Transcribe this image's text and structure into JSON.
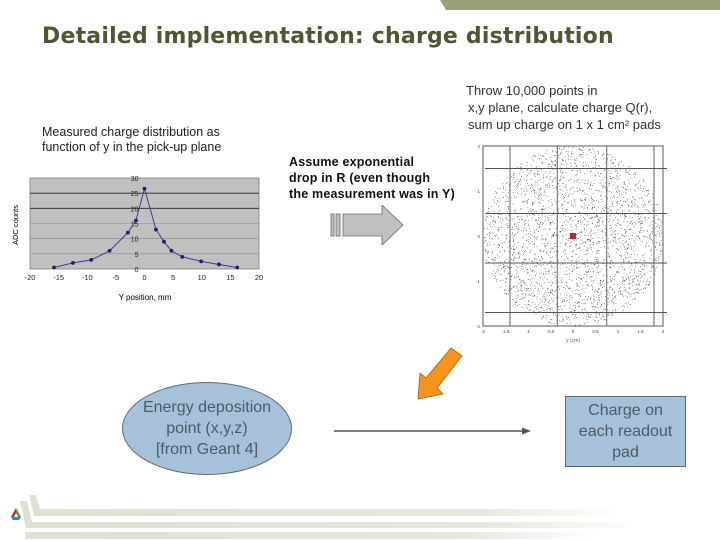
{
  "slide": {
    "title": "Detailed implementation: charge distribution",
    "measured_caption": [
      "Measured charge distribution as",
      "function of y in the pick-up plane"
    ],
    "throw_caption": [
      "Throw 10,000 points in",
      "x,y plane, calculate charge Q(r),",
      "sum up charge on 1 x 1 cm² pads"
    ],
    "assume_caption": [
      "Assume exponential",
      "drop in R (even though",
      "the measurement was in Y)"
    ],
    "ellipse_label": [
      "Energy deposition",
      "point (x,y,z)",
      "[from Geant 4]"
    ],
    "pad_label": [
      "Charge on",
      "each readout",
      "pad"
    ],
    "colors": {
      "title": "#4f5634",
      "top_band": "#9a9f78",
      "box_fill": "#a7c1db",
      "box_border": "#5b6b7c",
      "orange_arrow": "#f7941d",
      "grey_arrow": "#c0c0c0",
      "chart_bg": "#c0c0c0",
      "chart_line": "#2b2f8a",
      "footer_stripe": "#e3e4da"
    },
    "icons": {
      "logo": "argonne-triangle-logo",
      "grey_arrow": "right-arrow-icon",
      "orange_arrow": "down-left-arrow-icon",
      "flow_arrow": "right-line-arrow-icon"
    }
  },
  "chart_data": [
    {
      "type": "line",
      "title": "",
      "xlabel": "Y position, mm",
      "ylabel": "ADC counts",
      "xlim": [
        -20,
        20
      ],
      "ylim": [
        0,
        30
      ],
      "xticks": [
        "-20",
        "-15",
        "-10",
        "-5",
        "0",
        "5",
        "10",
        "15",
        "20"
      ],
      "yticks": [
        "0",
        "5",
        "10",
        "15",
        "20",
        "25",
        "30"
      ],
      "grid": true,
      "series": [
        {
          "name": "measured",
          "x": [
            -15.8,
            -12.5,
            -9.3,
            -6.1,
            -2.9,
            -1.5,
            0,
            2.0,
            3.4,
            4.7,
            6.6,
            9.9,
            13.0,
            16.2
          ],
          "y": [
            0.5,
            2.0,
            3.0,
            6.0,
            12.0,
            16.0,
            26.5,
            13.0,
            9.0,
            6.0,
            4.0,
            2.5,
            1.5,
            0.5
          ]
        }
      ]
    },
    {
      "type": "scatter",
      "title": "",
      "xlabel": "y (cm)",
      "ylabel": "",
      "xlim": [
        -2,
        2
      ],
      "ylim": [
        -2,
        2
      ],
      "xticks": [
        "-2",
        "-1.5",
        "-1",
        "-0.5",
        "0",
        "0.5",
        "1",
        "1.5",
        "2"
      ],
      "yticks": [
        "-2",
        "-1",
        "0",
        "1",
        "2"
      ],
      "n_points": 10000,
      "distribution": "uniform disk radius 2",
      "highlight_point": {
        "x": 0,
        "y": 0,
        "color": "#c0282d"
      },
      "pad_grid_lines_x": [
        -1.4,
        -0.35,
        0.75,
        1.8
      ],
      "pad_grid_lines_y": [
        1.5,
        0.5,
        -0.6,
        -1.7
      ]
    }
  ]
}
